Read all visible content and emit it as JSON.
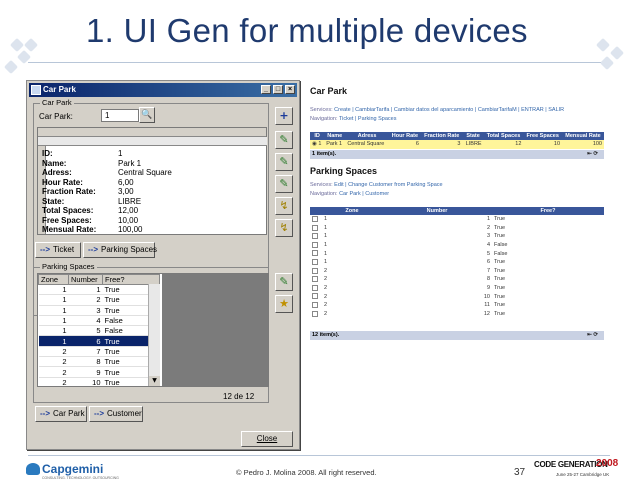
{
  "slide": {
    "title": "1. UI Gen for multiple devices",
    "copyright": "© Pedro J. Molina 2008. All right reserved.",
    "page_number": "37",
    "logo_left": "Capgemini",
    "logo_left_sub": "CONSULTING. TECHNOLOGY. OUTSOURCING",
    "logo_right": "CODE GENERATION",
    "logo_right_year": "2008",
    "logo_right_sub": "June 25-27 Cambridge UK"
  },
  "desktop": {
    "window_title": "Car Park",
    "titlebar_buttons": [
      "_",
      "□",
      "×"
    ],
    "group_car_park": "Car Park",
    "car_park_label": "Car Park:",
    "car_park_value": "1",
    "record": [
      {
        "k": "ID:",
        "v": "1"
      },
      {
        "k": "Name:",
        "v": "Park 1"
      },
      {
        "k": "Adress:",
        "v": "Central Square"
      },
      {
        "k": "Hour Rate:",
        "v": "6,00"
      },
      {
        "k": "Fraction Rate:",
        "v": "3,00"
      },
      {
        "k": "State:",
        "v": "LIBRE"
      },
      {
        "k": "Total Spaces:",
        "v": "12,00"
      },
      {
        "k": "Free Spaces:",
        "v": "10,00"
      },
      {
        "k": "Mensual Rate:",
        "v": "100,00"
      }
    ],
    "nav_ticket": "Ticket",
    "nav_parking_spaces": "Parking Spaces",
    "group_parking_spaces": "Parking Spaces",
    "columns": [
      "Zone",
      "Number",
      "Free?"
    ],
    "rows": [
      [
        "1",
        "1",
        "True"
      ],
      [
        "1",
        "2",
        "True"
      ],
      [
        "1",
        "3",
        "True"
      ],
      [
        "1",
        "4",
        "False"
      ],
      [
        "1",
        "5",
        "False"
      ],
      [
        "1",
        "6",
        "True"
      ],
      [
        "2",
        "7",
        "True"
      ],
      [
        "2",
        "8",
        "True"
      ],
      [
        "2",
        "9",
        "True"
      ],
      [
        "2",
        "10",
        "True"
      ]
    ],
    "selected_row": 5,
    "pager": "12 de 12",
    "nav_car_park": "Car Park",
    "nav_customer": "Customer",
    "close_label": "Close"
  },
  "web": {
    "title1": "Car Park",
    "services1_label": "Services:",
    "services1_links": "Create | CambiarTarifa | Cambiar datos del aparcamiento | CambiarTarifaM | ENTRAR | SALIR",
    "nav1_label": "Navigation:",
    "nav1_links": "Ticket | Parking Spaces",
    "table1_columns": [
      "ID",
      "Name",
      "Adress",
      "Hour Rate",
      "Fraction Rate",
      "State",
      "Total Spaces",
      "Free Spaces",
      "Mensual Rate"
    ],
    "table1_row": [
      "1",
      "Park 1",
      "Central Square",
      "6",
      "3",
      "LIBRE",
      "12",
      "10",
      "100"
    ],
    "table1_count": "1 item(s).",
    "title2": "Parking Spaces",
    "services2_label": "Services:",
    "services2_links": "Edit | Change Customer from Parking Space",
    "nav2_label": "Navigation:",
    "nav2_links": "Car Park | Customer",
    "table2_columns": [
      "Zone",
      "Number",
      "Free?"
    ],
    "table2_rows": [
      [
        "1",
        "1",
        "True"
      ],
      [
        "1",
        "2",
        "True"
      ],
      [
        "1",
        "3",
        "True"
      ],
      [
        "1",
        "4",
        "False"
      ],
      [
        "1",
        "5",
        "False"
      ],
      [
        "1",
        "6",
        "True"
      ],
      [
        "2",
        "7",
        "True"
      ],
      [
        "2",
        "8",
        "True"
      ],
      [
        "2",
        "9",
        "True"
      ],
      [
        "2",
        "10",
        "True"
      ],
      [
        "2",
        "11",
        "True"
      ],
      [
        "2",
        "12",
        "True"
      ]
    ],
    "table2_count": "12 item(s)."
  },
  "colors": {
    "title_blue": "#1f3a6e",
    "win_titlebar": "#0a246a",
    "web_header": "#39569a",
    "highlight_row": "#fff59a",
    "code_gen_red": "#c0181e"
  }
}
